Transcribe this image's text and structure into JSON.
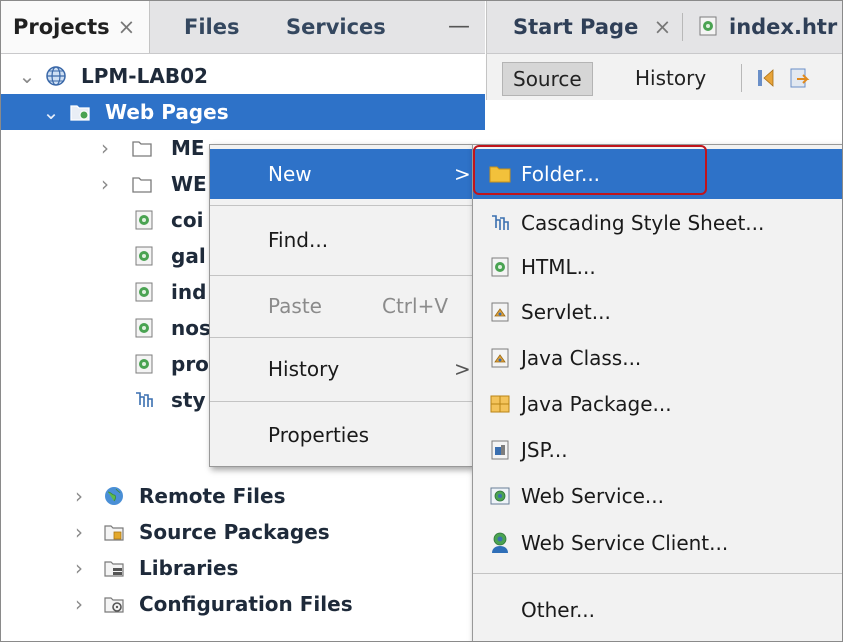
{
  "projects_panel": {
    "tabs": [
      {
        "label": "Projects",
        "close": "×",
        "active": true
      },
      {
        "label": "Files",
        "active": false
      },
      {
        "label": "Services",
        "active": false
      }
    ],
    "minimize": "—"
  },
  "tree": {
    "project": "LPM-LAB02",
    "web_pages": "Web Pages",
    "children": [
      "ME",
      "WE",
      "coi",
      "gal",
      "ind",
      "nos",
      "pro",
      "sty"
    ],
    "remote_files": "Remote Files",
    "source_packages": "Source Packages",
    "libraries": "Libraries",
    "configuration_files": "Configuration Files"
  },
  "editor": {
    "tabs": [
      {
        "label": "Start Page",
        "close": "×"
      },
      {
        "label": "index.htr"
      }
    ],
    "toolbar": {
      "source": "Source",
      "history": "History"
    }
  },
  "context_menu": {
    "new": "New",
    "find": "Find...",
    "paste": "Paste",
    "paste_shortcut": "Ctrl+V",
    "history": "History",
    "properties": "Properties",
    "submenu_arrow": ">"
  },
  "submenu": {
    "items": [
      {
        "label": "Folder...",
        "icon": "folder-icon"
      },
      {
        "label": "Cascading Style Sheet...",
        "icon": "css-icon"
      },
      {
        "label": "HTML...",
        "icon": "html-file-icon"
      },
      {
        "label": "Servlet...",
        "icon": "servlet-icon"
      },
      {
        "label": "Java Class...",
        "icon": "java-class-icon"
      },
      {
        "label": "Java Package...",
        "icon": "java-package-icon"
      },
      {
        "label": "JSP...",
        "icon": "jsp-icon"
      },
      {
        "label": "Web Service...",
        "icon": "web-service-icon"
      },
      {
        "label": "Web Service Client...",
        "icon": "web-service-client-icon"
      },
      {
        "label": "Other...",
        "icon": ""
      }
    ]
  },
  "colors": {
    "selection": "#2e72c8",
    "highlight_border": "#c0141b",
    "menu_background": "#f2f2f2"
  }
}
